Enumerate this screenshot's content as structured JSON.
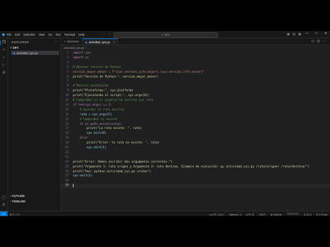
{
  "titlebar": {
    "menu": [
      "File",
      "Edit",
      "Selection",
      "View",
      "Go",
      "Run",
      "Terminal",
      "Help"
    ],
    "search_text": "DEV",
    "nav_arrows": "← →",
    "window_controls": [
      "—",
      "□",
      "✕"
    ]
  },
  "sidebar": {
    "title": "EXPLORER",
    "more": "···",
    "folder": "˅ DEV",
    "file": "actividad_sys.py",
    "outline": "› OUTLINE",
    "timeline": "› TIMELINE"
  },
  "tabs": [
    {
      "label": "Welcome",
      "icon": "≡"
    },
    {
      "label": "actividad_sys.py",
      "icon": "◆",
      "close": "×"
    }
  ],
  "breadcrumb": [
    "actividad_sys.py",
    "›",
    "..."
  ],
  "code_lines": [
    {
      "n": "1",
      "text": "import sys",
      "color": "#c586c0",
      "indent": 0
    },
    {
      "n": "2",
      "text": "import os",
      "color": "#c586c0",
      "indent": 0
    },
    {
      "n": "3",
      "text": "",
      "color": "#cccccc",
      "indent": 0
    },
    {
      "n": "4",
      "text": "# Obtener versión de Python",
      "color": "#6a9955",
      "indent": 0
    },
    {
      "n": "5",
      "text": "version_mayor_menor = f\"{sys.version_info.major}.{sys.version_info.minor}\"",
      "color": "#ce9178",
      "indent": 0
    },
    {
      "n": "6",
      "text": "print(\"Versión de Python:\", version_mayor_menor)",
      "color": "#dcdcaa",
      "indent": 0
    },
    {
      "n": "7",
      "text": "",
      "color": "#cccccc",
      "indent": 0
    },
    {
      "n": "8",
      "text": "# Mostrar plataforma",
      "color": "#6a9955",
      "indent": 0
    },
    {
      "n": "9",
      "text": "print(\"Plataforma:\", sys.platform)",
      "color": "#dcdcaa",
      "indent": 0
    },
    {
      "n": "10",
      "text": "print(\"Ejecutando el script:\", sys.argv[0])",
      "color": "#dcdcaa",
      "indent": 0
    },
    {
      "n": "11",
      "text": "# Comprobar si el usuario ha escrito una ruta",
      "color": "#6a9955",
      "indent": 0
    },
    {
      "n": "12",
      "text": "if len(sys.argv) == 2:",
      "color": "#c586c0",
      "indent": 0
    },
    {
      "n": "13",
      "text": "# Guardar la ruta escrita",
      "color": "#6a9955",
      "indent": 1
    },
    {
      "n": "14",
      "text": "ruta = sys.argv[1]",
      "color": "#9cdcfe",
      "indent": 1
    },
    {
      "n": "15",
      "text": "# Comprobar si existe",
      "color": "#6a9955",
      "indent": 1
    },
    {
      "n": "16",
      "text": "if os.path.exists(ruta):",
      "color": "#c586c0",
      "indent": 1
    },
    {
      "n": "17",
      "text": "print(\"La ruta existe: \", ruta)",
      "color": "#dcdcaa",
      "indent": 2
    },
    {
      "n": "18",
      "text": "sys.exit(0)",
      "color": "#9cdcfe",
      "indent": 2
    },
    {
      "n": "19",
      "text": "else:",
      "color": "#c586c0",
      "indent": 1
    },
    {
      "n": "20",
      "text": "print(\"Error: la ruta no existe: \", ruta)",
      "color": "#dcdcaa",
      "indent": 2
    },
    {
      "n": "21",
      "text": "sys.exit(1)",
      "color": "#9cdcfe",
      "indent": 2
    },
    {
      "n": "22",
      "text": "",
      "color": "#cccccc",
      "indent": 0
    },
    {
      "n": "23",
      "text": "",
      "color": "#cccccc",
      "indent": 0
    },
    {
      "n": "24",
      "text": "print(\"Error: Debes escribir dos argumentos correctos.\")",
      "color": "#dcdcaa",
      "indent": 0
    },
    {
      "n": "25",
      "text": "print(\"Argumento 1: ruta origen y Argumento 2: ruta destino. Ejemplo de ejecución: py actividad_sys.py /ruta/origen/ /ruta/destino/\")",
      "color": "#dcdcaa",
      "indent": 0
    },
    {
      "n": "26",
      "text": "print(\"Uso: python actividad_sys.py <ruta>\")",
      "color": "#dcdcaa",
      "indent": 0
    },
    {
      "n": "27",
      "text": "sys.exit(1)",
      "color": "#9cdcfe",
      "indent": 0
    },
    {
      "n": "28",
      "text": "",
      "color": "#cccccc",
      "indent": 0
    },
    {
      "n": "29",
      "text": "",
      "color": "#cccccc",
      "indent": 0
    }
  ],
  "current_line": "29",
  "statusbar": {
    "remote": "><",
    "left": "⊗ 0 ⚠ 0",
    "right": [
      "Ln 29, Col 1",
      "Spaces: 4",
      "UTF-8",
      "CRLF",
      "{} Python",
      "3.11.3",
      "⊙ 0 Curs"
    ]
  },
  "colors": {
    "accent": "#0078d4",
    "background": "#1f1f1f",
    "sidebar": "#181818"
  }
}
